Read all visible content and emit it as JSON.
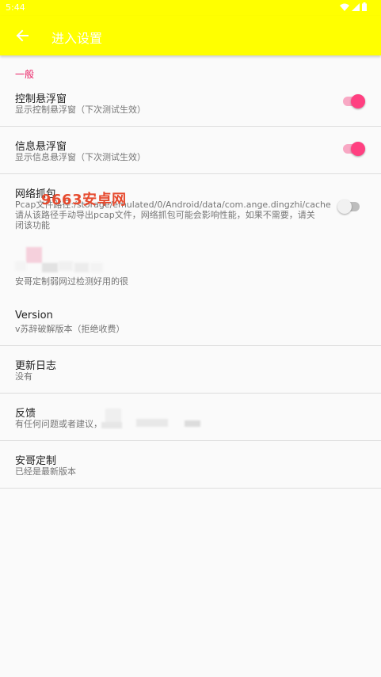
{
  "status_bar": {
    "time": "5:44"
  },
  "toolbar": {
    "back_icon": "arrow-back-icon",
    "title": "进入设置"
  },
  "section": {
    "header": "一般"
  },
  "prefs": {
    "control_window": {
      "title": "控制悬浮窗",
      "summary": "显示控制悬浮窗（下次测试生效）",
      "enabled": true
    },
    "info_window": {
      "title": "信息悬浮窗",
      "summary": "显示信息悬浮窗（下次测试生效）",
      "enabled": true
    },
    "capture": {
      "title": "网络抓包",
      "summary_line1": "Pcap文件路径:/storage/emulated/0/Android/data/com.ange.dingzhi/cache",
      "summary_line2": "请从该路径手动导出pcap文件，网络抓包可能会影响性能，如果不需要，请关",
      "summary_line3": "闭该功能",
      "enabled": false
    },
    "weak_net": {
      "summary": "安哥定制弱网过检测好用的很"
    },
    "version": {
      "title": "Version",
      "summary": "v苏辞破解版本（拒绝收费）"
    },
    "changelog": {
      "title": "更新日志",
      "summary": "没有"
    },
    "feedback": {
      "title": "反馈",
      "summary": "有任何问题或者建议，"
    },
    "custom": {
      "title": "安哥定制",
      "summary": "已经是最新版本"
    }
  },
  "watermark": "9663安卓网",
  "colors": {
    "toolbar": "#ffff00",
    "accent": "#ff4081",
    "section": "#e91e63",
    "watermark": "#e64a2e"
  }
}
